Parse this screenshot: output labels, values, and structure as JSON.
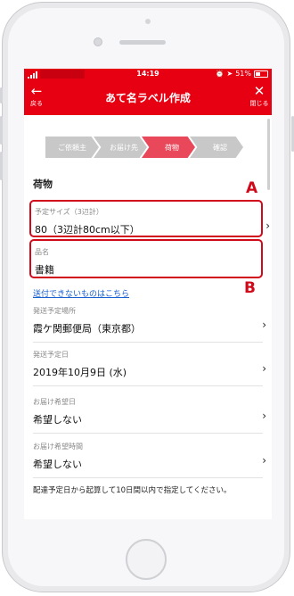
{
  "status_bar": {
    "time": "14:19",
    "battery": "51%",
    "alarm_icon": "alarm-icon",
    "location_icon": "location-arrow-icon"
  },
  "header": {
    "title": "あて名ラベル作成",
    "back_label": "戻る",
    "back_icon": "←",
    "close_label": "閉じる",
    "close_icon": "✕"
  },
  "steps": [
    {
      "label": "ご依頼主",
      "state": "done"
    },
    {
      "label": "お届け先",
      "state": "done"
    },
    {
      "label": "荷物",
      "state": "active"
    },
    {
      "label": "確認",
      "state": "todo"
    }
  ],
  "section_title": "荷物",
  "fields": {
    "size": {
      "label": "予定サイズ（3辺計）",
      "value": "80（3辺計80cm以下）"
    },
    "item_name": {
      "label": "品名",
      "value": "書籍"
    },
    "send_place": {
      "label": "発送予定場所",
      "value": "霞ケ関郵便局（東京都）"
    },
    "send_date": {
      "label": "発送予定日",
      "value": "2019年10月9日 (水)"
    },
    "delivery_date": {
      "label": "お届け希望日",
      "value": "希望しない"
    },
    "delivery_time": {
      "label": "お届け希望時間",
      "value": "希望しない"
    }
  },
  "link_text": "送付できないものはこちら",
  "note": "配達予定日から起算して10日間以内で指定してください。",
  "annotations": {
    "a": "A",
    "b": "B"
  },
  "colors": {
    "brand_red": "#e60012",
    "highlight": "#d0091b",
    "step_active": "#e9475a",
    "step_inactive": "#c8c8c8",
    "link": "#1a5fd0"
  }
}
